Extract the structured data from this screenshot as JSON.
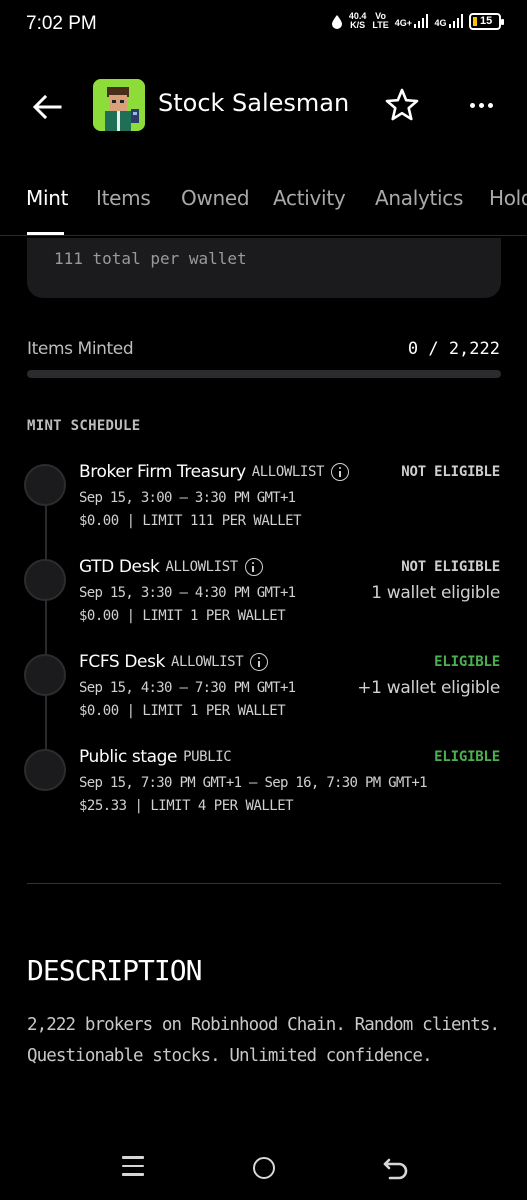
{
  "status_bar": {
    "time": "7:02 PM",
    "speed_value": "40.4",
    "speed_unit": "K/S",
    "volte_top": "Vo",
    "volte_bottom": "LTE",
    "net1": "4G+",
    "net2": "4G",
    "battery_level": "15"
  },
  "header": {
    "title": "Stock Salesman"
  },
  "tabs": [
    {
      "label": "Mint",
      "active": true
    },
    {
      "label": "Items"
    },
    {
      "label": "Owned"
    },
    {
      "label": "Activity"
    },
    {
      "label": "Analytics"
    },
    {
      "label": "Hold"
    }
  ],
  "card_peek_text": "111 total per wallet",
  "items_minted": {
    "label": "Items Minted",
    "value": "0 / 2,222",
    "progress": 0
  },
  "schedule": {
    "title": "MINT SCHEDULE",
    "stages": [
      {
        "name": "Broker Firm Treasury",
        "type": "ALLOWLIST",
        "has_info": true,
        "date": "Sep 15, 3:00 – 3:30 PM GMT+1",
        "price": "$0.00 | LIMIT 111 PER WALLET",
        "eligibility": "NOT ELIGIBLE",
        "eligible": false,
        "wallets": ""
      },
      {
        "name": "GTD Desk",
        "type": "ALLOWLIST",
        "has_info": true,
        "date": "Sep 15, 3:30 – 4:30 PM GMT+1",
        "price": "$0.00 | LIMIT 1 PER WALLET",
        "eligibility": "NOT ELIGIBLE",
        "eligible": false,
        "wallets": "1 wallet eligible"
      },
      {
        "name": "FCFS Desk",
        "type": "ALLOWLIST",
        "has_info": true,
        "date": "Sep 15, 4:30 – 7:30 PM GMT+1",
        "price": "$0.00 | LIMIT 1 PER WALLET",
        "eligibility": "ELIGIBLE",
        "eligible": true,
        "wallets": "+1 wallet eligible"
      },
      {
        "name": "Public stage",
        "type": "PUBLIC",
        "has_info": false,
        "date": "Sep 15, 7:30 PM GMT+1 – Sep 16, 7:30 PM GMT+1",
        "price": "$25.33 | LIMIT 4 PER WALLET",
        "eligibility": "ELIGIBLE",
        "eligible": true,
        "wallets": ""
      }
    ]
  },
  "description": {
    "title": "DESCRIPTION",
    "text": "2,222 brokers on Robinhood Chain. Random clients. Questionable stocks. Unlimited confidence."
  },
  "colors": {
    "background": "#000000",
    "eligible_green": "#4caf50",
    "card": "#1b1b1d",
    "avatar_bg": "#8ddc3a"
  }
}
